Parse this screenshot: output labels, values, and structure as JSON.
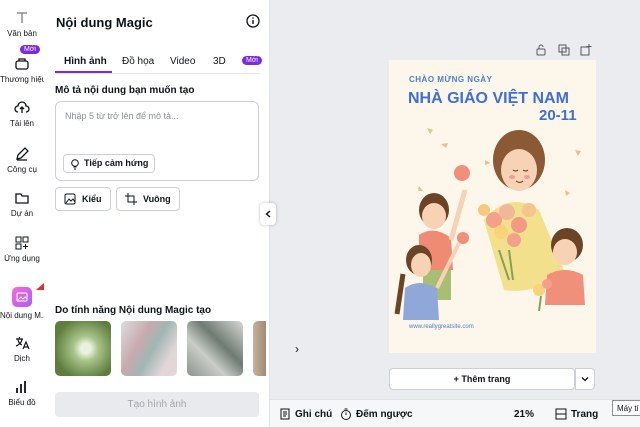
{
  "rail": {
    "items": [
      {
        "label": "Văn bản",
        "icon": "text-icon"
      },
      {
        "label": "Thương hiệu",
        "icon": "brand-icon",
        "badge": "Mới"
      },
      {
        "label": "Tải lên",
        "icon": "upload-icon"
      },
      {
        "label": "Công cụ",
        "icon": "pen-icon"
      },
      {
        "label": "Dự án",
        "icon": "folder-icon"
      },
      {
        "label": "Ứng dụng",
        "icon": "apps-icon"
      },
      {
        "label": "Nội dung M...",
        "icon": "magic-media-icon"
      },
      {
        "label": "Dịch",
        "icon": "translate-icon"
      },
      {
        "label": "Biểu đồ",
        "icon": "chart-icon"
      }
    ]
  },
  "panel": {
    "title": "Nội dung Magic",
    "tabs": [
      {
        "label": "Hình ảnh",
        "active": true
      },
      {
        "label": "Đồ họa"
      },
      {
        "label": "Video"
      },
      {
        "label": "3D",
        "badge": "Mới"
      }
    ],
    "description_label": "Mô tả nội dung bạn muốn tạo",
    "prompt_placeholder": "Nhập 5 từ trở lên để mô tả...",
    "inspire_label": "Tiếp cảm hứng",
    "style_label": "Kiểu",
    "ratio_label": "Vuông",
    "magic_section_label": "Do tính năng Nội dung Magic tạo",
    "generate_label": "Tạo hình ảnh"
  },
  "design": {
    "small_title": "CHÀO MỪNG NGÀY",
    "big_title": "NHÀ GIÁO VIỆT NAM",
    "date": "20-11",
    "url": "www.reallygreatsite.com"
  },
  "canvas": {
    "add_page_label": "+ Thêm trang"
  },
  "bottom_bar": {
    "notes_label": "Ghi chú",
    "timer_label": "Đếm ngược",
    "zoom": "21%",
    "pages_label": "Trang",
    "tooltip": "Máy tí"
  },
  "colors": {
    "accent": "#7d2ae8",
    "design_bg": "#fdf6ea",
    "title_blue": "#3e6fd6"
  }
}
